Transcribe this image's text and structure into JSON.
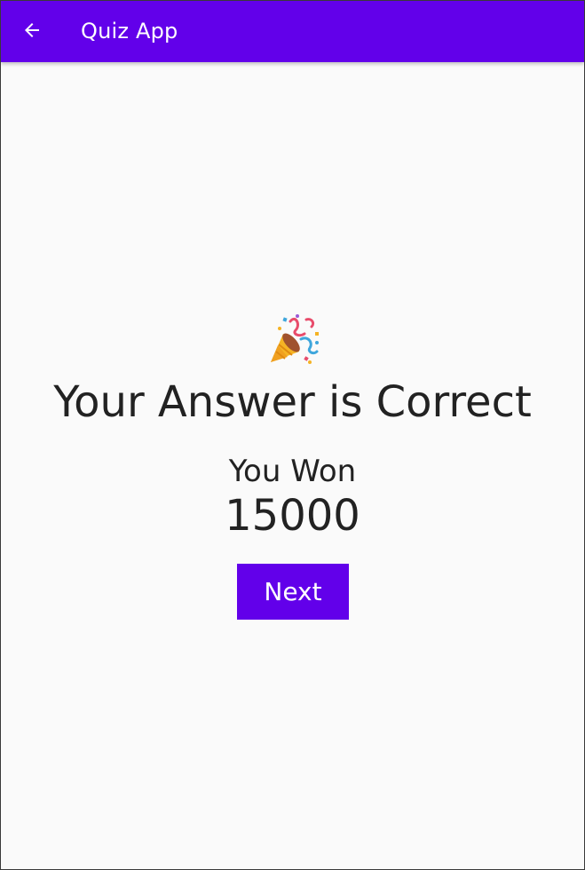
{
  "app_bar": {
    "title": "Quiz App",
    "back_icon": "arrow-left-icon",
    "background": "#6200ea"
  },
  "result": {
    "icon": "party-popper-icon",
    "headline": "Your Answer is Correct",
    "won_label": "You Won",
    "amount": "15000",
    "next_label": "Next"
  },
  "colors": {
    "accent": "#6200ea",
    "text": "#222222",
    "background": "#fafafa"
  }
}
